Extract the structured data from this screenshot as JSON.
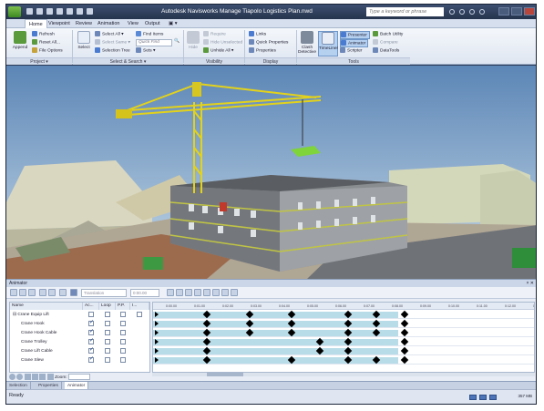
{
  "app": {
    "title": "Autodesk Navisworks Manage   Tiapolo Logistics Plan.nwd",
    "search_placeholder": "Type a keyword or phrase"
  },
  "tabs": [
    "Home",
    "Viewpoint",
    "Review",
    "Animation",
    "View",
    "Output"
  ],
  "ribbon": {
    "project": {
      "append": "Append",
      "refresh": "Refresh",
      "reset_all": "Reset All...",
      "file_options": "File Options",
      "label": "Project ▾"
    },
    "select_search": {
      "select": "Select",
      "select_all": "Select All ▾",
      "select_same": "Select Same ▾",
      "selection_tree": "Selection Tree",
      "find_items": "Find Items",
      "quick_find": "Quick Find",
      "sets": "Sets",
      "label": "Select & Search ▾"
    },
    "visibility": {
      "hide": "Hide",
      "require": "Require",
      "hide_unselected": "Hide Unselected",
      "unhide_all": "Unhide All ▾",
      "label": "Visibility"
    },
    "display": {
      "links": "Links",
      "quick_properties": "Quick Properties",
      "properties": "Properties",
      "label": "Display"
    },
    "tools": {
      "clash_detective": "Clash Detective",
      "timeliner": "TimeLiner",
      "presenter": "Presenter",
      "animator": "Animator",
      "scripter": "Scripter",
      "batch_utility": "Batch Utility",
      "compare": "Compare",
      "datatools": "DataTools",
      "label": "Tools"
    }
  },
  "animator": {
    "panel_title": "Animator",
    "close": "× ✕",
    "translate_placeholder": "Translation",
    "time_value": "0:00.00",
    "columns": [
      "Name",
      "Ac...",
      "Loop",
      "P.P.",
      "I..."
    ],
    "rows": [
      {
        "name": "⊟ Crane Equip Lift",
        "ac": false,
        "loop": false,
        "pp": false
      },
      {
        "name": "Crane Hook",
        "ac": true,
        "loop": false,
        "pp": false
      },
      {
        "name": "Crane Hook Cable",
        "ac": true,
        "loop": false,
        "pp": false
      },
      {
        "name": "Crane Trolley",
        "ac": true,
        "loop": false,
        "pp": false
      },
      {
        "name": "Crane Lift Cable",
        "ac": true,
        "loop": false,
        "pp": false
      },
      {
        "name": "Crane Slew",
        "ac": true,
        "loop": false,
        "pp": false
      }
    ],
    "zoom_label": "Zoom:",
    "ticks": [
      "0:00.00",
      "0:01.00",
      "0:02.00",
      "0:03.00",
      "0:04.00",
      "0:05.00",
      "0:06.00",
      "0:07.00",
      "0:08.00",
      "0:09.00",
      "0:10.00",
      "0:11.00",
      "0:12.00",
      "0:13.00"
    ]
  },
  "bottom_tabs": [
    "Selection",
    "Properties",
    "Animator"
  ],
  "status": {
    "text": "Ready",
    "memory": "357 MB"
  },
  "colors": {
    "accent": "#2b3a55",
    "lane": "#b9dde8",
    "crane": "#e3d21a"
  }
}
